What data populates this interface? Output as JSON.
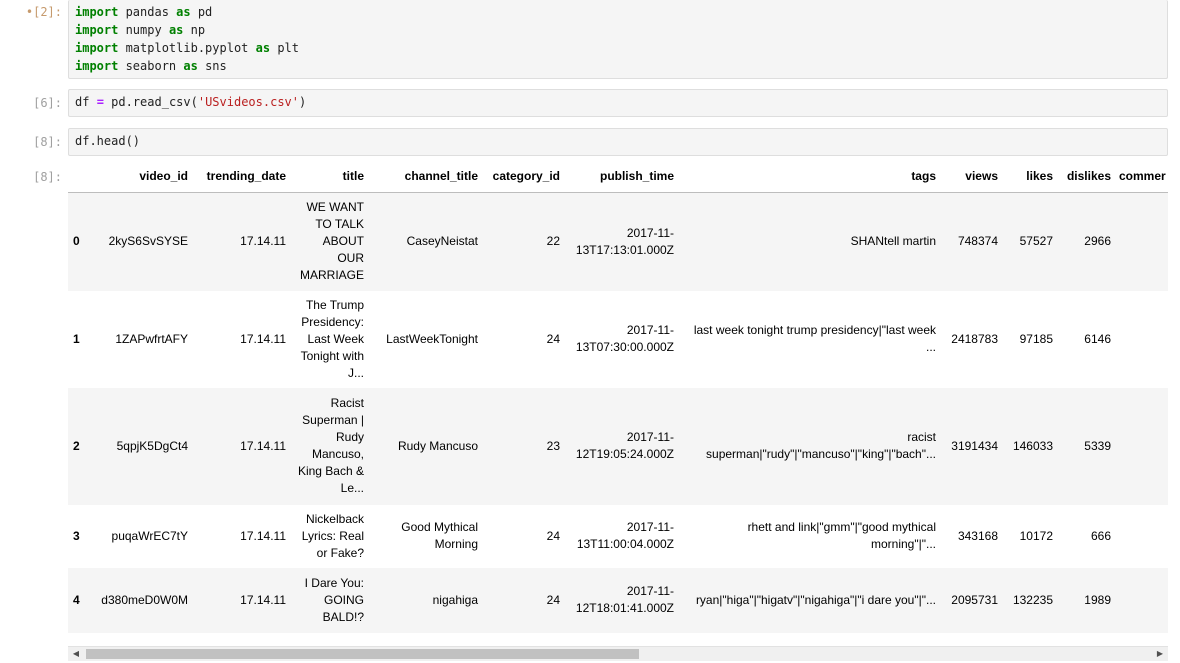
{
  "cells": [
    {
      "prompt": "•[2]:",
      "lines": [
        [
          {
            "t": "import",
            "c": "kw"
          },
          {
            "t": " pandas "
          },
          {
            "t": "as",
            "c": "kw"
          },
          {
            "t": " pd"
          }
        ],
        [
          {
            "t": "import",
            "c": "kw"
          },
          {
            "t": " numpy "
          },
          {
            "t": "as",
            "c": "kw"
          },
          {
            "t": " np"
          }
        ],
        [
          {
            "t": "import",
            "c": "kw"
          },
          {
            "t": " matplotlib.pyplot "
          },
          {
            "t": "as",
            "c": "kw"
          },
          {
            "t": " plt"
          }
        ],
        [
          {
            "t": "import",
            "c": "kw"
          },
          {
            "t": " seaborn "
          },
          {
            "t": "as",
            "c": "kw"
          },
          {
            "t": " sns"
          }
        ]
      ]
    },
    {
      "prompt": "[6]:",
      "lines": [
        [
          {
            "t": "df "
          },
          {
            "t": "=",
            "c": "op"
          },
          {
            "t": " pd.read_csv("
          },
          {
            "t": "'USvideos.csv'",
            "c": "str"
          },
          {
            "t": ")"
          }
        ]
      ]
    },
    {
      "prompt": "[8]:",
      "lines": [
        [
          {
            "t": "df.head()"
          }
        ]
      ]
    }
  ],
  "output": {
    "prompt": "[8]:",
    "columns": [
      "",
      "video_id",
      "trending_date",
      "title",
      "channel_title",
      "category_id",
      "publish_time",
      "tags",
      "views",
      "likes",
      "dislikes",
      "commer"
    ],
    "rows": [
      {
        "index": "0",
        "video_id": "2kyS6SvSYSE",
        "trending_date": "17.14.11",
        "title": "WE WANT TO TALK ABOUT OUR MARRIAGE",
        "channel_title": "CaseyNeistat",
        "category_id": "22",
        "publish_time": "2017-11-13T17:13:01.000Z",
        "tags": "SHANtell martin",
        "views": "748374",
        "likes": "57527",
        "dislikes": "2966",
        "comments": ""
      },
      {
        "index": "1",
        "video_id": "1ZAPwfrtAFY",
        "trending_date": "17.14.11",
        "title": "The Trump Presidency: Last Week Tonight with J...",
        "channel_title": "LastWeekTonight",
        "category_id": "24",
        "publish_time": "2017-11-13T07:30:00.000Z",
        "tags": "last week tonight trump presidency|\"last week ...",
        "views": "2418783",
        "likes": "97185",
        "dislikes": "6146",
        "comments": ""
      },
      {
        "index": "2",
        "video_id": "5qpjK5DgCt4",
        "trending_date": "17.14.11",
        "title": "Racist Superman | Rudy Mancuso, King Bach & Le...",
        "channel_title": "Rudy Mancuso",
        "category_id": "23",
        "publish_time": "2017-11-12T19:05:24.000Z",
        "tags": "racist superman|\"rudy\"|\"mancuso\"|\"king\"|\"bach\"...",
        "views": "3191434",
        "likes": "146033",
        "dislikes": "5339",
        "comments": ""
      },
      {
        "index": "3",
        "video_id": "puqaWrEC7tY",
        "trending_date": "17.14.11",
        "title": "Nickelback Lyrics: Real or Fake?",
        "channel_title": "Good Mythical Morning",
        "category_id": "24",
        "publish_time": "2017-11-13T11:00:04.000Z",
        "tags": "rhett and link|\"gmm\"|\"good mythical morning\"|\"...",
        "views": "343168",
        "likes": "10172",
        "dislikes": "666",
        "comments": ""
      },
      {
        "index": "4",
        "video_id": "d380meD0W0M",
        "trending_date": "17.14.11",
        "title": "I Dare You: GOING BALD!?",
        "channel_title": "nigahiga",
        "category_id": "24",
        "publish_time": "2017-11-12T18:01:41.000Z",
        "tags": "ryan|\"higa\"|\"higatv\"|\"nigahiga\"|\"i dare you\"|\"...",
        "views": "2095731",
        "likes": "132235",
        "dislikes": "1989",
        "comments": ""
      }
    ]
  },
  "scrollbar": {
    "left_arrow": "◀",
    "right_arrow": "▶",
    "thumb_fraction": 0.52
  }
}
